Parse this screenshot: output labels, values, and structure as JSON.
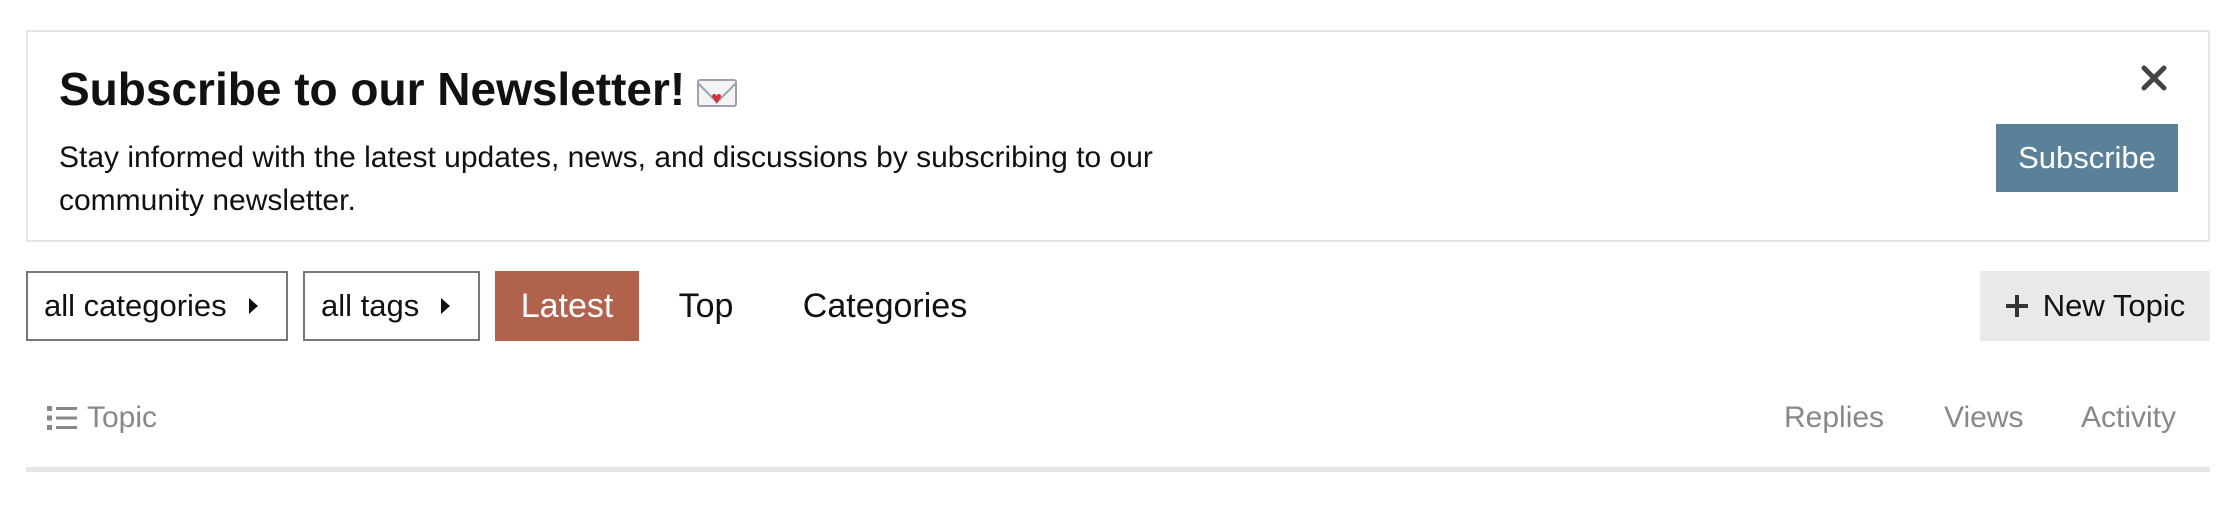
{
  "banner": {
    "title": "Subscribe to our Newsletter!",
    "title_icon": "love-letter-envelope-icon",
    "description": "Stay informed with the latest updates, news, and discussions by subscribing to our community newsletter.",
    "subscribe_label": "Subscribe",
    "close_icon": "close-icon",
    "subscribe_color": "#5b8199"
  },
  "nav": {
    "categories_dropdown": "all categories",
    "tags_dropdown": "all tags",
    "tabs": [
      {
        "label": "Latest",
        "active": true
      },
      {
        "label": "Top",
        "active": false
      },
      {
        "label": "Categories",
        "active": false
      }
    ],
    "active_color": "#b1624d",
    "new_topic_label": "New Topic",
    "new_topic_icon": "plus-icon"
  },
  "list_header": {
    "topic_label": "Topic",
    "topic_icon": "list-icon",
    "replies_label": "Replies",
    "views_label": "Views",
    "activity_label": "Activity"
  }
}
